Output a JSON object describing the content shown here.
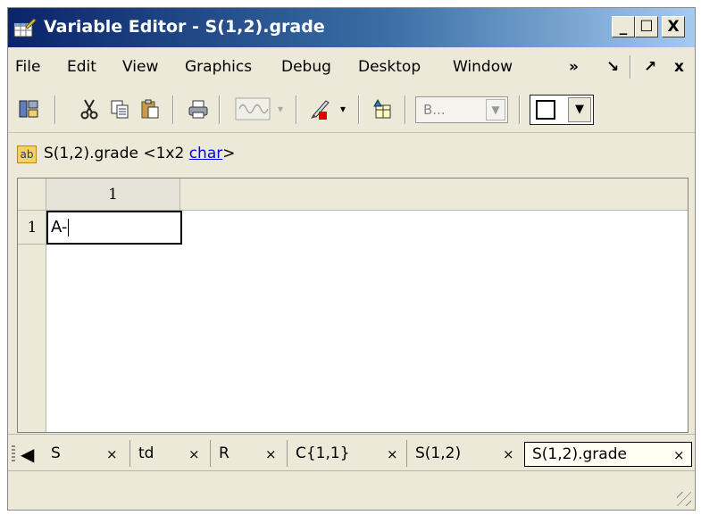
{
  "window": {
    "title": "Variable Editor - S(1,2).grade",
    "controls": {
      "minimize": "_",
      "maximize": "☐",
      "close": "X"
    }
  },
  "menu": {
    "items": [
      "File",
      "Edit",
      "View",
      "Graphics",
      "Debug",
      "Desktop",
      "Window"
    ],
    "overflow": "»",
    "undock": "↘",
    "dock": "↗",
    "close": "x"
  },
  "toolbar": {
    "font_select_value": "B...",
    "icons": [
      "workspace-icon",
      "cut-icon",
      "copy-icon",
      "paste-icon",
      "print-icon",
      "plot-icon",
      "brush-icon",
      "brush-dropdown-icon",
      "new-variable-icon",
      "font-select",
      "border-select"
    ]
  },
  "variable": {
    "icon": "ab",
    "name": "S(1,2).grade",
    "size_prefix": "<1x2 ",
    "type": "char",
    "size_suffix": ">"
  },
  "grid": {
    "column_headers": [
      "1"
    ],
    "row_headers": [
      "1"
    ],
    "cells": [
      [
        "A-"
      ]
    ]
  },
  "tabs": [
    {
      "label": "S",
      "close": "×"
    },
    {
      "label": "td",
      "close": "×"
    },
    {
      "label": "R",
      "close": "×"
    },
    {
      "label": "C{1,1}",
      "close": "×"
    },
    {
      "label": "S(1,2)",
      "close": "×"
    },
    {
      "label": "S(1,2).grade",
      "close": "×",
      "active": true
    }
  ]
}
